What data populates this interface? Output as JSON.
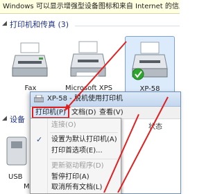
{
  "infobar": {
    "text": "Windows 可以显示增强型设备图标和来自 Internet 的信息。请单"
  },
  "sections": {
    "printers": "打印机和传真 (3)",
    "devices": "设备"
  },
  "devices": [
    {
      "label": "Fax"
    },
    {
      "label": "Microsoft XPS"
    },
    {
      "label": "XP-58"
    }
  ],
  "usb_device": {
    "label_line1": "USB",
    "label_line2": "M"
  },
  "queue_window": {
    "title": "XP-58 - 脱机使用打印机",
    "menus": [
      "打印机(P)",
      "文档(D)",
      "查看(V)"
    ],
    "column_header": "状态"
  },
  "printer_menu": {
    "items": [
      {
        "label": "连接(O)",
        "disabled": true,
        "checked": false
      },
      {
        "label": "设置为默认打印机(A)",
        "disabled": false,
        "checked": true
      },
      {
        "label": "打印首选项(E)...",
        "disabled": false,
        "checked": false
      },
      {
        "label": "更新驱动程序(D)",
        "disabled": true,
        "checked": false
      },
      {
        "label": "暂停打印(A)",
        "disabled": false,
        "checked": false
      },
      {
        "label": "取消所有文档(L)",
        "disabled": false,
        "checked": false
      }
    ]
  },
  "colors": {
    "accent_red": "#e02020",
    "section_blue": "#1e3287",
    "selection_blue": "#dcebfc",
    "default_check_green": "#2fa52f"
  }
}
